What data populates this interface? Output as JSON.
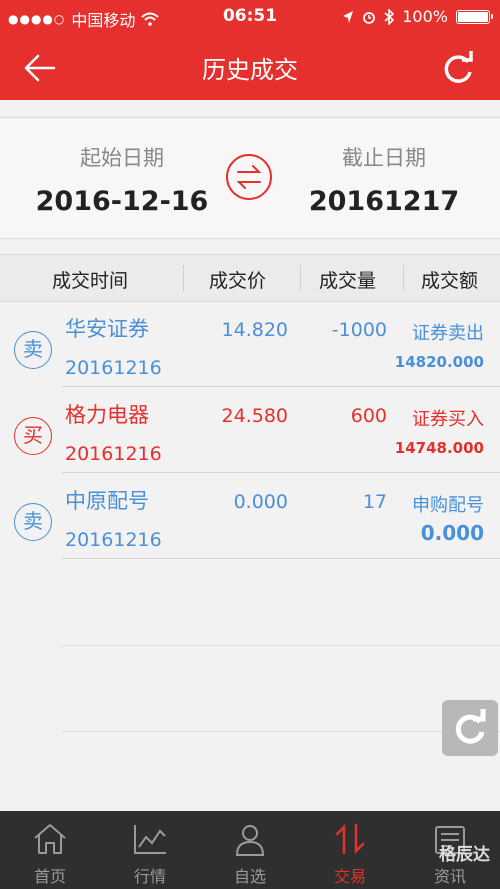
{
  "status": {
    "carrier": "中国移动",
    "time": "06:51",
    "battery": "100%"
  },
  "nav": {
    "title": "历史成交"
  },
  "dates": {
    "start_label": "起始日期",
    "start_value": "2016-12-16",
    "end_label": "截止日期",
    "end_value": "20161217"
  },
  "table": {
    "headers": [
      "成交时间",
      "成交价",
      "成交量",
      "成交额"
    ],
    "rows": [
      {
        "side": "卖",
        "name": "华安证券",
        "date": "20161216",
        "price": "14.820",
        "qty": "-1000",
        "type": "证券卖出",
        "amount": "14820.000",
        "color": "#4a90d9"
      },
      {
        "side": "买",
        "name": "格力电器",
        "date": "20161216",
        "price": "24.580",
        "qty": "600",
        "type": "证券买入",
        "amount": "14748.000",
        "color": "#e5302e"
      },
      {
        "side": "卖",
        "name": "中原配号",
        "date": "20161216",
        "price": "0.000",
        "qty": "17",
        "type": "申购配号",
        "amount": "0.000",
        "color": "#4a90d9"
      }
    ]
  },
  "tabs": [
    {
      "label": "首页",
      "icon": "home-icon"
    },
    {
      "label": "行情",
      "icon": "chart-icon"
    },
    {
      "label": "自选",
      "icon": "user-icon"
    },
    {
      "label": "交易",
      "icon": "trade-icon",
      "active": true
    },
    {
      "label": "资讯",
      "icon": "news-icon"
    }
  ],
  "watermark": "格辰达",
  "colors": {
    "accent": "#e5302e",
    "sell": "#4a90d9",
    "buy": "#e5302e"
  }
}
